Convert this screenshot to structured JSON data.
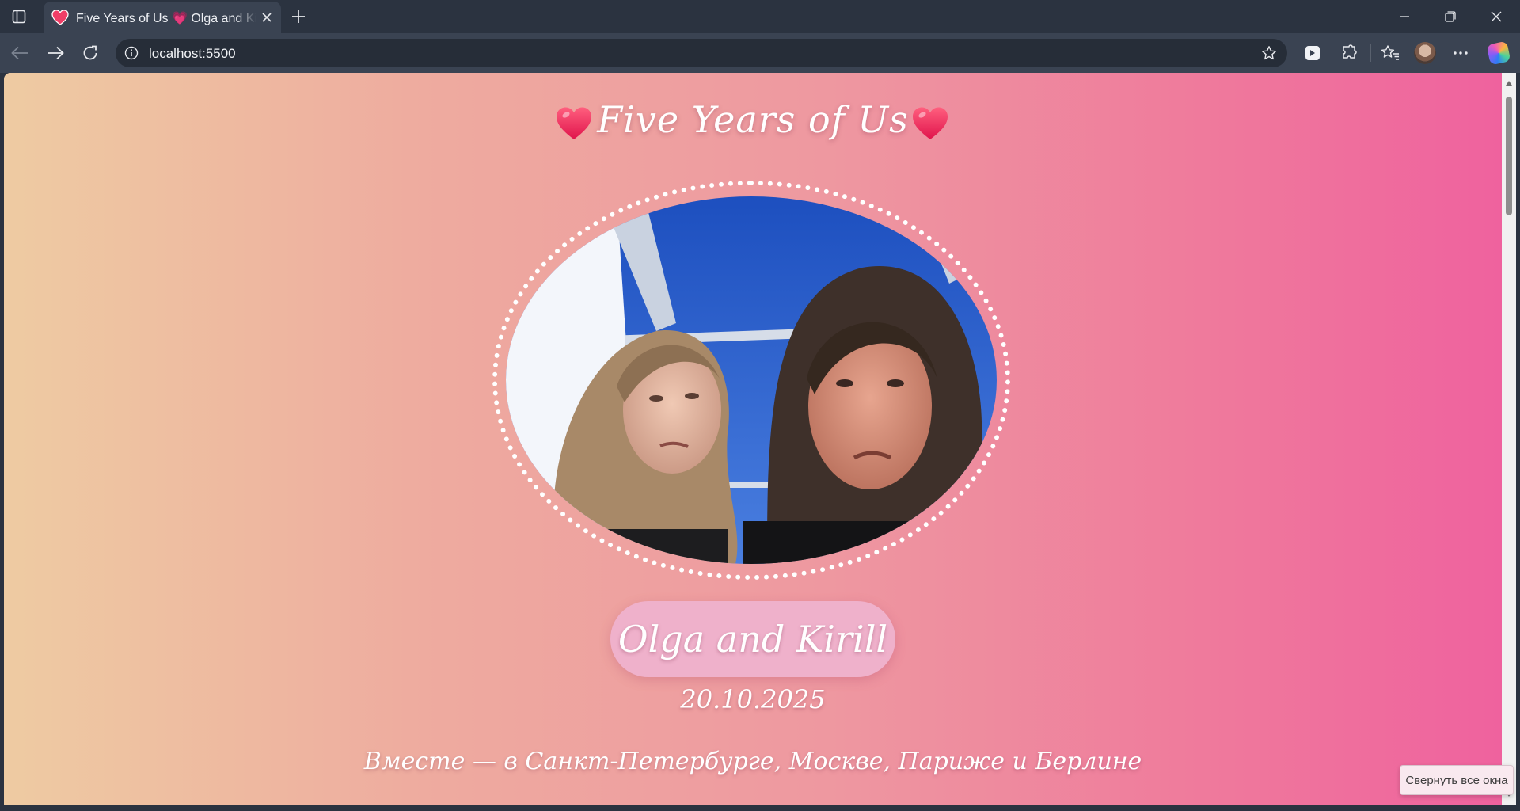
{
  "browser": {
    "tab": {
      "title": "Five Years of Us 💗 Olga and Kirill",
      "favicon": "heart-icon"
    },
    "address_bar": {
      "url": "localhost:5500"
    },
    "icons": [
      "sidebar-toggle-icon",
      "close-icon",
      "plus-icon",
      "minimize-icon",
      "restore-icon",
      "window-close-icon",
      "back-icon",
      "forward-icon",
      "reload-icon",
      "site-info-icon",
      "star-icon",
      "extension-shield-icon",
      "puzzle-icon",
      "favorites-icon",
      "avatar",
      "more-icon",
      "copilot-icon"
    ],
    "colors": {
      "frame": "#2b3340",
      "toolbar": "#3a4352",
      "omnibox": "#262d38"
    }
  },
  "page": {
    "title": "Five Years of Us",
    "names": "Olga and Kirill",
    "date": "20.10.2025",
    "tagline": "Вместе — в Санкт-Петербурге, Москве, Париже и Берлине",
    "photo_description": "selfie-couple-photo",
    "colors": {
      "gradient_start": "#eecba2",
      "gradient_end": "#ef629e",
      "pill": "#efb1cb",
      "heart": "#ef2f5e"
    }
  },
  "tooltip": {
    "text": "Свернуть все окна"
  }
}
